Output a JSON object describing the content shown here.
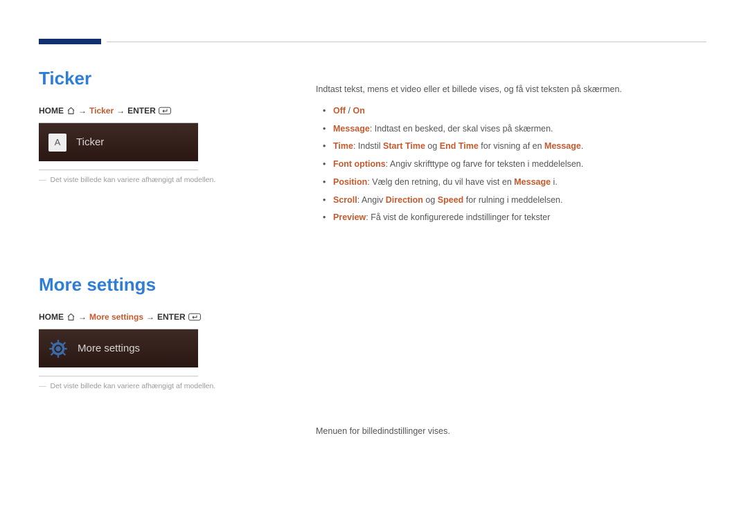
{
  "section1": {
    "heading": "Ticker",
    "breadcrumb": {
      "home": "HOME",
      "mid": "Ticker",
      "enter": "ENTER"
    },
    "tile": {
      "icon_letter": "A",
      "label": "Ticker"
    },
    "note": "Det viste billede kan variere afhængigt af modellen.",
    "intro": "Indtast tekst, mens et video eller et billede vises, og få vist teksten på skærmen.",
    "bullet1": {
      "off": "Off",
      "sep": " / ",
      "on": "On"
    },
    "bullet2": {
      "k": "Message",
      "rest": ": Indtast en besked, der skal vises på skærmen."
    },
    "bullet3": {
      "k": "Time",
      "t1": ": Indstil ",
      "s": "Start Time",
      "t2": " og ",
      "e": "End Time",
      "t3": " for visning af en ",
      "m": "Message",
      "dot": "."
    },
    "bullet4": {
      "k": "Font options",
      "rest": ": Angiv skrifttype og farve for teksten i meddelelsen."
    },
    "bullet5": {
      "k": "Position",
      "t1": ": Vælg den retning, du vil have vist en ",
      "m": "Message",
      "t2": " i."
    },
    "bullet6": {
      "k": "Scroll",
      "t1": ": Angiv ",
      "d": "Direction",
      "t2": " og ",
      "s": "Speed",
      "t3": " for rulning i meddelelsen."
    },
    "bullet7": {
      "k": "Preview",
      "rest": ": Få vist de konfigurerede indstillinger for tekster"
    }
  },
  "section2": {
    "heading": "More settings",
    "breadcrumb": {
      "home": "HOME",
      "mid": "More settings",
      "enter": "ENTER"
    },
    "tile": {
      "label": "More settings"
    },
    "note": "Det viste billede kan variere afhængigt af modellen.",
    "intro": "Menuen for billedindstillinger vises."
  }
}
